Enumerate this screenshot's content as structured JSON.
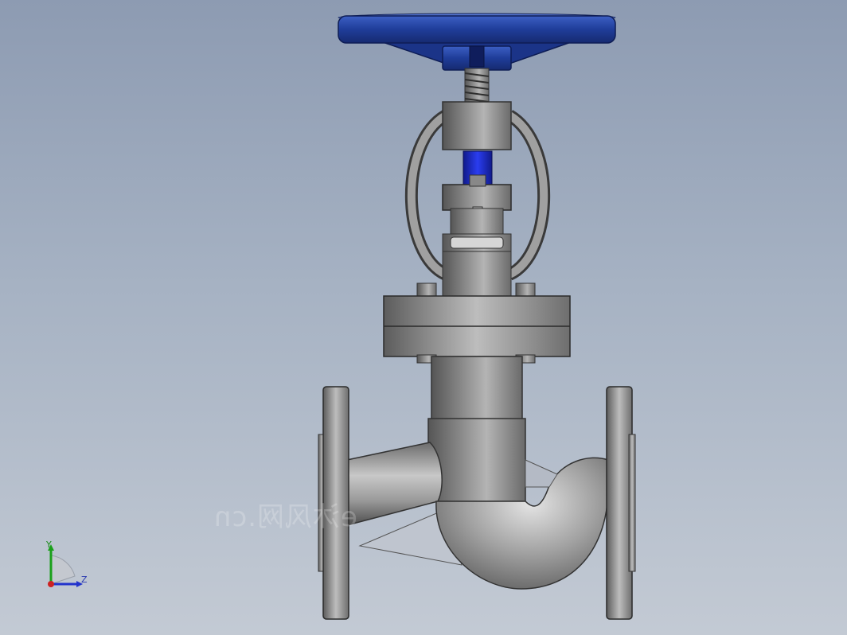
{
  "viewport": {
    "background_top": "#8d9bb2",
    "background_bottom": "#c3cad4"
  },
  "model": {
    "handwheel_color": "#1f3d99",
    "stem_insert_color": "#1f2fc8",
    "body_color": "#9a9a9a"
  },
  "watermark": {
    "text": "e沐风网.cn"
  },
  "triad": {
    "y_label": "Y",
    "z_label": "Z",
    "y_color": "#1aa01a",
    "z_color": "#2233cc",
    "x_color": "#cc2222"
  }
}
